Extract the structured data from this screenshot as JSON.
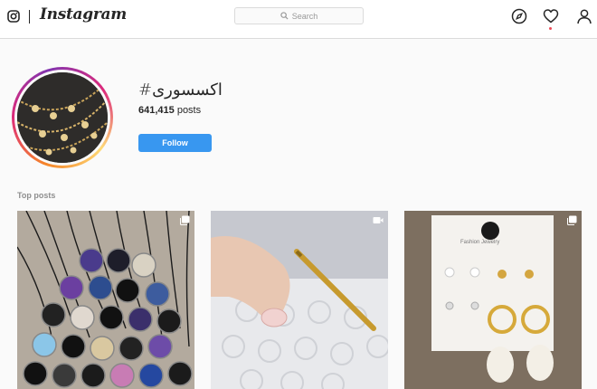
{
  "nav": {
    "brand": "Instagram",
    "search_placeholder": "Search",
    "icons": [
      "camera-icon",
      "compass-icon",
      "heart-icon",
      "profile-icon"
    ]
  },
  "header": {
    "hashtag": "#اکسسوری",
    "post_count": "641,415",
    "post_count_suffix": " posts",
    "follow_label": "Follow"
  },
  "top_posts": {
    "section_label": "Top posts",
    "posts": [
      {
        "badge": "multiple-photos-icon"
      },
      {
        "badge": "video-icon"
      },
      {
        "badge": "multiple-photos-icon",
        "card_text": "Fashion Jewelry"
      }
    ]
  },
  "colors": {
    "accent": "#3897f0",
    "border": "#dbdbdb",
    "muted_text": "#8e8e8e",
    "notification": "#ed4956"
  }
}
